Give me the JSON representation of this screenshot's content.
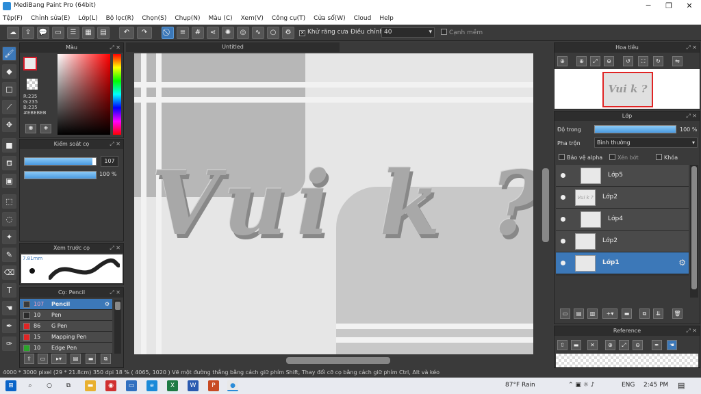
{
  "window": {
    "title": "MediBang Paint Pro (64bit)"
  },
  "menu": [
    "Tệp(F)",
    "Chỉnh sửa(E)",
    "Lớp(L)",
    "Bộ lọc(R)",
    "Chọn(S)",
    "Chụp(N)",
    "Màu (C)",
    "Xem(V)",
    "Công cụ(T)",
    "Cửa sổ(W)",
    "Cloud",
    "Help"
  ],
  "toolbar": {
    "antialias_label": "Khử răng cưa",
    "adjust_label": "Điều chỉnh",
    "adjust_value": "40",
    "edge_label": "Cạnh mềm"
  },
  "color_panel": {
    "title": "Màu",
    "r": "R:235",
    "g": "G:235",
    "b": "B:235",
    "hex": "#EBEBEB",
    "fg_color": "#EBEBEB",
    "accent": "#D81B2A"
  },
  "brush_control": {
    "title": "Kiểm soát cọ",
    "size": "107",
    "opacity": "100 %",
    "size_fraction": 0.95,
    "opacity_fraction": 1.0
  },
  "brush_preview": {
    "title": "Xem trước cọ",
    "size_label": "7.81mm"
  },
  "brush_list": {
    "title": "Cọ: Pencil",
    "items": [
      {
        "size": "107",
        "name": "Pencil",
        "color": "#3a3a3a",
        "selected": true
      },
      {
        "size": "10",
        "name": "Pen",
        "color": "#2a2a2a",
        "selected": false
      },
      {
        "size": "86",
        "name": "G Pen",
        "color": "#e02424",
        "selected": false
      },
      {
        "size": "15",
        "name": "Mapping Pen",
        "color": "#e02424",
        "selected": false
      },
      {
        "size": "10",
        "name": "Edge Pen",
        "color": "#2aa52a",
        "selected": false
      }
    ]
  },
  "canvas": {
    "tab": "Untitled",
    "artwork_text": "Vui k ?"
  },
  "navigator": {
    "title": "Hoa tiêu",
    "thumb_text": "Vui k ?"
  },
  "layers": {
    "title": "Lớp",
    "opacity_label": "Độ trong",
    "opacity_value": "100 %",
    "opacity_fraction": 1.0,
    "blend_label": "Pha trộn",
    "blend_value": "Bình thường",
    "protect_alpha": "Bảo vệ alpha",
    "clip": "Xén bớt",
    "lock": "Khóa",
    "items": [
      {
        "name": "Lớp5",
        "thumb": "",
        "selected": false,
        "indent": true
      },
      {
        "name": "Lớp2",
        "thumb": "Vui k ?",
        "selected": false,
        "indent": false
      },
      {
        "name": "Lớp4",
        "thumb": "",
        "selected": false,
        "indent": true
      },
      {
        "name": "Lớp2",
        "thumb": "",
        "selected": false,
        "indent": false
      },
      {
        "name": "Lớp1",
        "thumb": "",
        "selected": true,
        "indent": false
      }
    ]
  },
  "reference": {
    "title": "Reference"
  },
  "status": {
    "text": "4000 * 3000 pixel  (29 * 21.8cm)  350 dpi  18 %  ( 4065, 1020 )  Vẽ một đường thẳng bằng cách giữ phím Shift, Thay đổi cỡ cọ bằng cách giữ phím Ctrl, Alt và kéo"
  },
  "taskbar": {
    "weather": "87°F Rain",
    "lang": "ENG",
    "time": "2:45 PM"
  }
}
